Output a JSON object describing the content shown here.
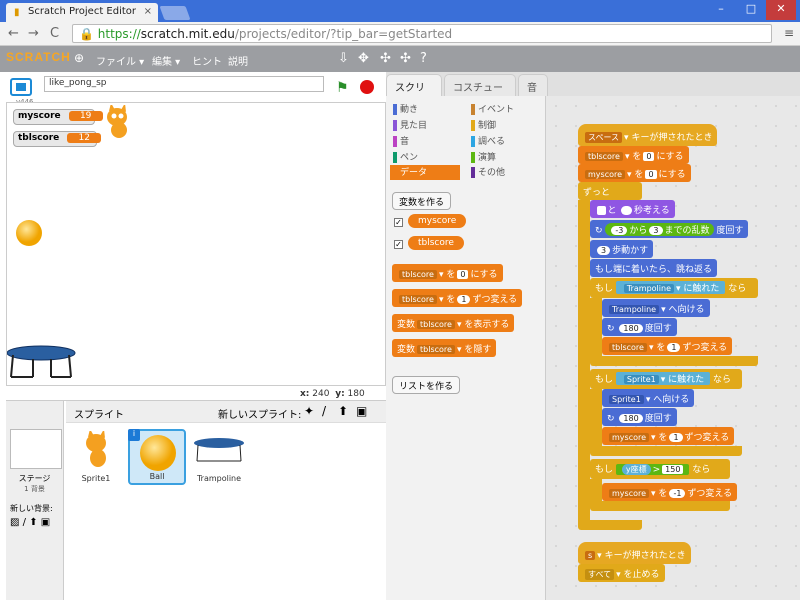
{
  "browser": {
    "tab_title": "Scratch Project Editor",
    "tab_close": "×",
    "url_scheme": "https://",
    "url_host": "scratch.mit.edu",
    "url_path": "/projects/editor/?tip_bar=getStarted",
    "back": "←",
    "forward": "→",
    "reload": "C",
    "menu": "≡",
    "min": "–",
    "max": "□",
    "close": "✕"
  },
  "menubar": {
    "logo": "SCRATCH",
    "globe": "⊕",
    "items": [
      "ファイル ▾",
      "編集 ▾",
      "ヒント",
      "説明"
    ],
    "tools": [
      "⇩",
      "✥",
      "✣",
      "✣",
      "?"
    ]
  },
  "stage_header": {
    "version": "v446",
    "project_name": "like_pong_sp",
    "flag": "⚑"
  },
  "stage": {
    "monitors": [
      {
        "name": "myscore",
        "value": "19"
      },
      {
        "name": "tblscore",
        "value": "12"
      }
    ],
    "coords": {
      "x_label": "x:",
      "x": "240",
      "y_label": "y:",
      "y": "180"
    }
  },
  "sprites": {
    "header": "スプライト",
    "new_label": "新しいスプライト:",
    "tools": [
      "✦",
      "/",
      "⬆",
      "▣"
    ],
    "stage_label": "ステージ",
    "stage_sub": "1 背景",
    "new_bg": "新しい背景:",
    "bg_tools": [
      "▨",
      "/",
      "⬆",
      "▣"
    ],
    "items": [
      {
        "name": "Sprite1"
      },
      {
        "name": "Ball"
      },
      {
        "name": "Trampoline"
      }
    ],
    "info": "i"
  },
  "tabs": [
    "スクリプト",
    "コスチューム",
    "音"
  ],
  "categories": {
    "left": [
      "動き",
      "見た目",
      "音",
      "ペン",
      "データ"
    ],
    "right": [
      "イベント",
      "制御",
      "調べる",
      "演算",
      "その他"
    ],
    "left_colors": [
      "#4a6cd4",
      "#8a55d7",
      "#bb42c3",
      "#0e9a6c",
      "#ee7d16"
    ],
    "right_colors": [
      "#c88330",
      "#e1a91a",
      "#2ca5e2",
      "#5cb712",
      "#632d99"
    ]
  },
  "palette": {
    "make_var": "変数を作る",
    "vars": [
      "myscore",
      "tblscore"
    ],
    "check": "✓",
    "b1": {
      "v": "tblscore",
      "t1": "を",
      "n": "0",
      "t2": "にする"
    },
    "b2": {
      "v": "tblscore",
      "t1": "を",
      "n": "1",
      "t2": "ずつ変える"
    },
    "b3": {
      "t0": "変数",
      "v": "tblscore",
      "t1": "を表示する"
    },
    "b4": {
      "t0": "変数",
      "v": "tblscore",
      "t1": "を隠す"
    },
    "make_list": "リストを作る"
  },
  "script": {
    "hat1": {
      "key": "スペース",
      "t": "キーが押されたとき"
    },
    "s1": {
      "v": "tblscore",
      "t1": "を",
      "n": "0",
      "t2": "にする"
    },
    "s2": {
      "v": "myscore",
      "t1": "を",
      "n": "0",
      "t2": "にする"
    },
    "forever": "ずっと",
    "think": {
      "t1": "と",
      "t2": "秒考える"
    },
    "turn_rand": {
      "a": "-3",
      "t1": "から",
      "b": "3",
      "t2": "までの乱数",
      "t3": "度回す"
    },
    "move": {
      "n": "3",
      "t": "歩動かす"
    },
    "bounce": "もし端に着いたら、跳ね返る",
    "if1": {
      "t1": "もし",
      "obj": "Trampoline",
      "t2": "に触れた",
      "t3": "なら"
    },
    "point1": {
      "obj": "Trampoline",
      "t": "へ向ける"
    },
    "turn1": {
      "n": "180",
      "t": "度回す"
    },
    "chg1": {
      "v": "tblscore",
      "t1": "を",
      "n": "1",
      "t2": "ずつ変える"
    },
    "if2": {
      "t1": "もし",
      "obj": "Sprite1",
      "t2": "に触れた",
      "t3": "なら"
    },
    "point2": {
      "obj": "Sprite1",
      "t": "へ向ける"
    },
    "turn2": {
      "n": "180",
      "t": "度回す"
    },
    "chg2": {
      "v": "myscore",
      "t1": "を",
      "n": "1",
      "t2": "ずつ変える"
    },
    "if3": {
      "t1": "もし",
      "cmp": "y座標",
      "op": ">",
      "n": "150",
      "t3": "なら"
    },
    "chg3": {
      "v": "myscore",
      "t1": "を",
      "n": "-1",
      "t2": "ずつ変える"
    },
    "hat2": {
      "key": "s",
      "t": "キーが押されたとき"
    },
    "stop": {
      "opt": "すべて",
      "t": "を止める"
    }
  }
}
